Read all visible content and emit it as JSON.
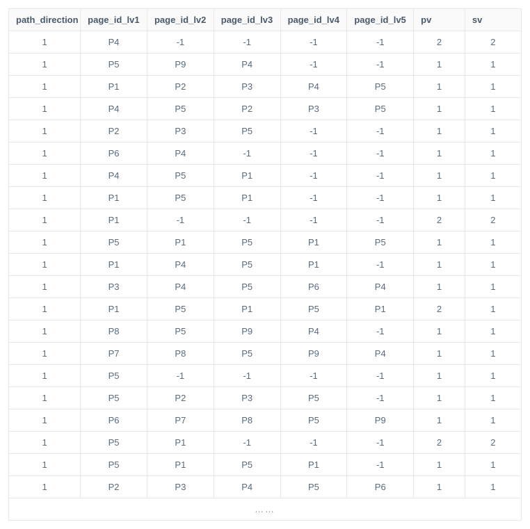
{
  "table": {
    "headers": [
      "path_direction",
      "page_id_lv1",
      "page_id_lv2",
      "page_id_lv3",
      "page_id_lv4",
      "page_id_lv5",
      "pv",
      "sv"
    ],
    "rows": [
      [
        "1",
        "P4",
        "-1",
        "-1",
        "-1",
        "-1",
        "2",
        "2"
      ],
      [
        "1",
        "P5",
        "P9",
        "P4",
        "-1",
        "-1",
        "1",
        "1"
      ],
      [
        "1",
        "P1",
        "P2",
        "P3",
        "P4",
        "P5",
        "1",
        "1"
      ],
      [
        "1",
        "P4",
        "P5",
        "P2",
        "P3",
        "P5",
        "1",
        "1"
      ],
      [
        "1",
        "P2",
        "P3",
        "P5",
        "-1",
        "-1",
        "1",
        "1"
      ],
      [
        "1",
        "P6",
        "P4",
        "-1",
        "-1",
        "-1",
        "1",
        "1"
      ],
      [
        "1",
        "P4",
        "P5",
        "P1",
        "-1",
        "-1",
        "1",
        "1"
      ],
      [
        "1",
        "P1",
        "P5",
        "P1",
        "-1",
        "-1",
        "1",
        "1"
      ],
      [
        "1",
        "P1",
        "-1",
        "-1",
        "-1",
        "-1",
        "2",
        "2"
      ],
      [
        "1",
        "P5",
        "P1",
        "P5",
        "P1",
        "P5",
        "1",
        "1"
      ],
      [
        "1",
        "P1",
        "P4",
        "P5",
        "P1",
        "-1",
        "1",
        "1"
      ],
      [
        "1",
        "P3",
        "P4",
        "P5",
        "P6",
        "P4",
        "1",
        "1"
      ],
      [
        "1",
        "P1",
        "P5",
        "P1",
        "P5",
        "P1",
        "2",
        "1"
      ],
      [
        "1",
        "P8",
        "P5",
        "P9",
        "P4",
        "-1",
        "1",
        "1"
      ],
      [
        "1",
        "P7",
        "P8",
        "P5",
        "P9",
        "P4",
        "1",
        "1"
      ],
      [
        "1",
        "P5",
        "-1",
        "-1",
        "-1",
        "-1",
        "1",
        "1"
      ],
      [
        "1",
        "P5",
        "P2",
        "P3",
        "P5",
        "-1",
        "1",
        "1"
      ],
      [
        "1",
        "P6",
        "P7",
        "P8",
        "P5",
        "P9",
        "1",
        "1"
      ],
      [
        "1",
        "P5",
        "P1",
        "-1",
        "-1",
        "-1",
        "2",
        "2"
      ],
      [
        "1",
        "P5",
        "P1",
        "P5",
        "P1",
        "-1",
        "1",
        "1"
      ],
      [
        "1",
        "P2",
        "P3",
        "P4",
        "P5",
        "P6",
        "1",
        "1"
      ]
    ],
    "ellipsis": "……"
  }
}
